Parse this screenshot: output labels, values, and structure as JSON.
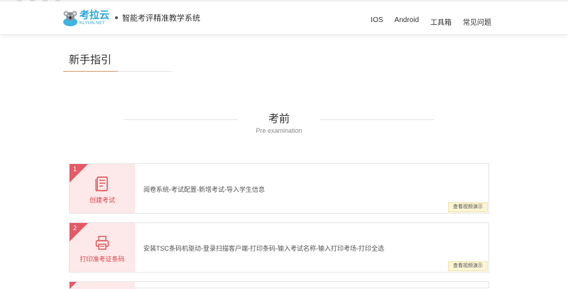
{
  "header": {
    "logo_cn": "考拉云",
    "logo_en": "KLYUN.NET",
    "subtitle": "智能考评精准教学系统",
    "nav": [
      "IOS",
      "Android",
      "工具箱",
      "常见问题"
    ]
  },
  "page_title": "新手指引",
  "section": {
    "title": "考前",
    "subtitle": "Pre examination"
  },
  "steps": [
    {
      "num": "1",
      "label": "创建考试",
      "icon": "document-list-icon",
      "desc": "阅卷系统-考试配置-新增考试-导入学生信息",
      "button": "查看视频演示"
    },
    {
      "num": "2",
      "label": "打印准考证条码",
      "icon": "printer-icon",
      "desc": "安装TSC条码机驱动-登录扫描客户端-打印条码-输入考试名称-输入打印考场-打印全选",
      "button": "查看视频演示"
    }
  ],
  "colors": {
    "accent_red": "#e45a66",
    "card_pink": "#fde9e9",
    "brand_blue": "#2aa7d9",
    "tab_underline": "#d89f72"
  }
}
